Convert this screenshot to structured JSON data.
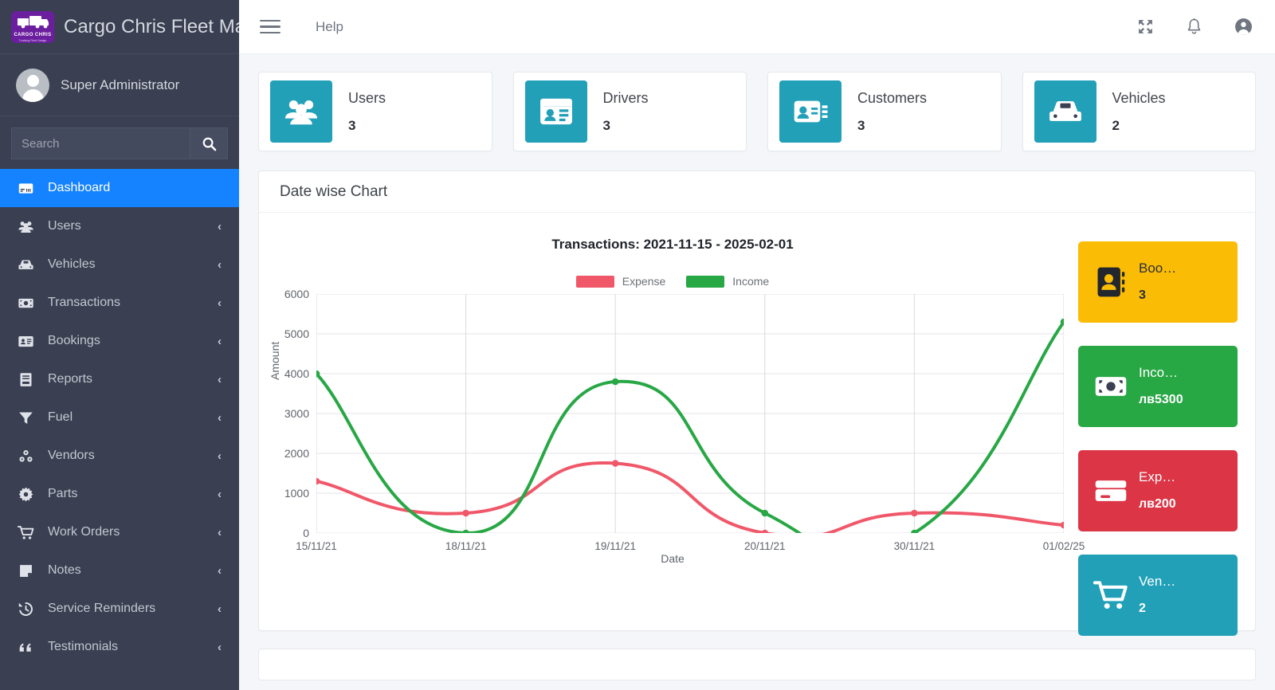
{
  "brand": {
    "title": "Cargo Chris Fleet Man",
    "logo_text": "CARGO CHRIS",
    "logo_sub": "Trucking Fleet Design"
  },
  "user": {
    "name": "Super Administrator"
  },
  "search": {
    "placeholder": "Search",
    "value": "",
    "icon": "search-icon"
  },
  "sidebar": {
    "items": [
      {
        "label": "Dashboard",
        "icon": "dashboard-icon",
        "active": true,
        "chevron": ""
      },
      {
        "label": "Users",
        "icon": "users-icon",
        "active": false,
        "chevron": "‹"
      },
      {
        "label": "Vehicles",
        "icon": "car-icon",
        "active": false,
        "chevron": "‹"
      },
      {
        "label": "Transactions",
        "icon": "money-icon",
        "active": false,
        "chevron": "‹"
      },
      {
        "label": "Bookings",
        "icon": "id-card-icon",
        "active": false,
        "chevron": "‹"
      },
      {
        "label": "Reports",
        "icon": "book-icon",
        "active": false,
        "chevron": "‹"
      },
      {
        "label": "Fuel",
        "icon": "funnel-icon",
        "active": false,
        "chevron": "‹"
      },
      {
        "label": "Vendors",
        "icon": "cubes-icon",
        "active": false,
        "chevron": "‹"
      },
      {
        "label": "Parts",
        "icon": "gear-icon",
        "active": false,
        "chevron": "‹"
      },
      {
        "label": "Work Orders",
        "icon": "cart-icon",
        "active": false,
        "chevron": "‹"
      },
      {
        "label": "Notes",
        "icon": "note-icon",
        "active": false,
        "chevron": "‹"
      },
      {
        "label": "Service Reminders",
        "icon": "history-icon",
        "active": false,
        "chevron": "‹"
      },
      {
        "label": "Testimonials",
        "icon": "quote-icon",
        "active": false,
        "chevron": "‹"
      }
    ]
  },
  "topbar": {
    "menu_icon": "hamburger-icon",
    "help_label": "Help",
    "icons": [
      "fullscreen-icon",
      "bell-icon",
      "account-icon"
    ]
  },
  "stats": [
    {
      "label": "Users",
      "value": "3",
      "icon": "users-icon",
      "color": "#21a0b8"
    },
    {
      "label": "Drivers",
      "value": "3",
      "icon": "drivers-card-icon",
      "color": "#21a0b8"
    },
    {
      "label": "Customers",
      "value": "3",
      "icon": "customers-card-icon",
      "color": "#21a0b8"
    },
    {
      "label": "Vehicles",
      "value": "2",
      "icon": "car-icon",
      "color": "#21a0b8"
    }
  ],
  "panel": {
    "title": "Date wise Chart"
  },
  "tiles": [
    {
      "label": "Boo…",
      "value": "3",
      "icon": "address-book-icon",
      "color": "#fbbc05",
      "dark": true
    },
    {
      "label": "Inco…",
      "value": "лв5300",
      "icon": "money-icon",
      "color": "#28a745",
      "dark": false
    },
    {
      "label": "Exp…",
      "value": "лв200",
      "icon": "credit-card-icon",
      "color": "#dc3545",
      "dark": false
    },
    {
      "label": "Ven…",
      "value": "2",
      "icon": "cart-icon",
      "color": "#21a0b8",
      "dark": false
    }
  ],
  "chart_data": {
    "type": "line",
    "title": "Transactions: 2021-11-15 - 2025-02-01",
    "xlabel": "Date",
    "ylabel": "Amount",
    "categories": [
      "15/11/21",
      "18/11/21",
      "19/11/21",
      "20/11/21",
      "30/11/21",
      "01/02/25"
    ],
    "yticks": [
      0,
      1000,
      2000,
      3000,
      4000,
      5000,
      6000
    ],
    "ylim": [
      0,
      6000
    ],
    "grid": true,
    "legend_position": "top-center",
    "series": [
      {
        "name": "Expense",
        "color": "#f0586a",
        "values": [
          1300,
          500,
          1750,
          0,
          500,
          200
        ]
      },
      {
        "name": "Income",
        "color": "#28a745",
        "values": [
          4000,
          0,
          3800,
          500,
          0,
          5300
        ]
      }
    ]
  }
}
